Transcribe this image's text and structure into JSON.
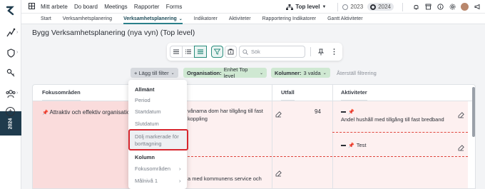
{
  "topbar": {
    "menu": [
      "Mitt arbete",
      "Do board",
      "Meetings",
      "Rapporter",
      "Forms"
    ],
    "level": "Top level",
    "years": [
      "2023",
      "2024"
    ],
    "selected_year": "2024"
  },
  "subnav": {
    "tabs": [
      "Start",
      "Verksamhetsplanering",
      "Verksamhetsplanering",
      "Indikatorer",
      "Aktiviteter",
      "Rapportering Indikatorer",
      "Gantt Aktiviteter"
    ],
    "active_index": 2
  },
  "rail": {
    "year": "2024"
  },
  "page": {
    "title": "Bygg Verksamhetsplanering (nya vyn) (Top level)"
  },
  "toolbar": {
    "search_placeholder": "Sök"
  },
  "filters": {
    "add_filter": "+ Lägg till filter",
    "org_label": "Organisation:",
    "org_value": "Enhet Top level",
    "col_label": "Kolumner:",
    "col_value": "3 valda",
    "reset": "Återställ filtrering"
  },
  "table": {
    "headers": {
      "fokus": "Fokusområden",
      "utfall": "Utfall",
      "aktiviteter": "Aktiviteter"
    },
    "fokus_item": "Attraktiv och effektiv organisation",
    "goal_line1": "vånarna dom har tillgång till fast",
    "goal_line2": "koppling",
    "goal2_line1": "a med kommunens service och",
    "utfall_value": "94",
    "activity1": "Andel hushåll med tillgång till fast bredband",
    "activity2": "Test"
  },
  "dropdown": {
    "general_header": "Allmänt",
    "general_items": [
      "Period",
      "Startdatum",
      "Slutdatum"
    ],
    "highlighted": "Dölj markerade för borttagning",
    "column_header": "Kolumn",
    "column_items": [
      "Fokusområden",
      "Målnivå 1"
    ]
  },
  "colors": {
    "accent": "#2a8c7c",
    "highlight": "#d7262e",
    "row_pink": "#fdf0f0",
    "fokus_pink": "#fadcdc"
  }
}
